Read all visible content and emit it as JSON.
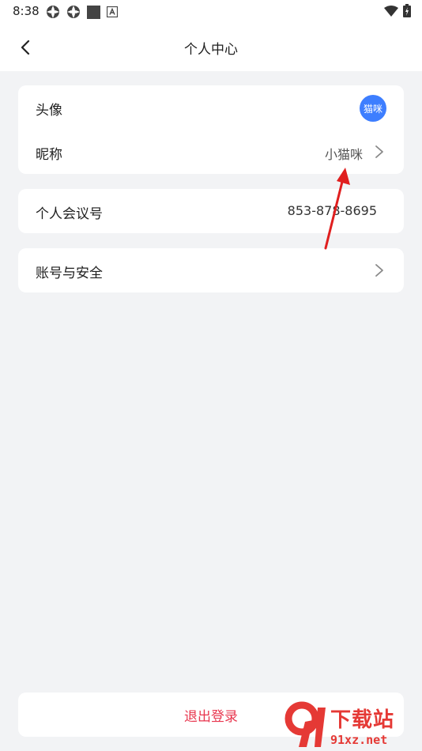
{
  "status_bar": {
    "time": "8:38",
    "icons": [
      "notification-icon",
      "notification-icon",
      "square-icon",
      "a-icon",
      "wifi-icon",
      "battery-icon"
    ]
  },
  "header": {
    "title": "个人中心",
    "back_icon": "back-arrow-icon"
  },
  "profile_card": {
    "avatar_label": "头像",
    "avatar_text": "猫咪",
    "nickname_label": "昵称",
    "nickname_value": "小猫咪"
  },
  "meeting_card": {
    "label": "个人会议号",
    "value": "853-878-8695"
  },
  "security_card": {
    "label": "账号与安全"
  },
  "logout": {
    "label": "退出登录"
  },
  "colors": {
    "background": "#f2f3f5",
    "card": "#ffffff",
    "avatar": "#3d7eff",
    "logout_text": "#e8364e",
    "annotation_arrow": "#e01f1f"
  },
  "watermark": {
    "brand": "下载站",
    "url": "91xz.net"
  }
}
